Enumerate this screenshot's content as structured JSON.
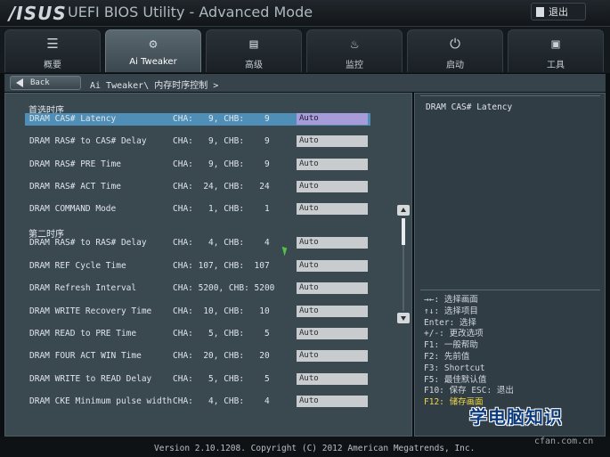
{
  "header": {
    "logo": "/ISUS",
    "title": "UEFI BIOS Utility - Advanced Mode",
    "exit_label": "退出"
  },
  "tabs": [
    {
      "label": "概要",
      "icon": "list-icon",
      "active": false
    },
    {
      "label": "Ai Tweaker",
      "icon": "ai-tweaker-icon",
      "active": true
    },
    {
      "label": "高级",
      "icon": "advanced-icon",
      "active": false
    },
    {
      "label": "监控",
      "icon": "monitor-icon",
      "active": false
    },
    {
      "label": "启动",
      "icon": "power-icon",
      "active": false
    },
    {
      "label": "工具",
      "icon": "toolbox-icon",
      "active": false
    }
  ],
  "nav": {
    "back_label": "Back",
    "breadcrumb": "Ai Tweaker\\  内存时序控制 >"
  },
  "sections": {
    "primary": "首选时序",
    "secondary": "第二时序"
  },
  "rows": [
    {
      "name": "DRAM CAS# Latency",
      "cha": "CHA:   9, CHB:    9",
      "value": "Auto",
      "selected": true
    },
    {
      "name": "DRAM RAS# to CAS# Delay",
      "cha": "CHA:   9, CHB:    9",
      "value": "Auto"
    },
    {
      "name": "DRAM RAS# PRE Time",
      "cha": "CHA:   9, CHB:    9",
      "value": "Auto"
    },
    {
      "name": "DRAM RAS# ACT Time",
      "cha": "CHA:  24, CHB:   24",
      "value": "Auto"
    },
    {
      "name": "DRAM COMMAND Mode",
      "cha": "CHA:   1, CHB:    1",
      "value": "Auto"
    },
    {
      "name": "DRAM RAS# to RAS# Delay",
      "cha": "CHA:   4, CHB:    4",
      "value": "Auto"
    },
    {
      "name": "DRAM REF Cycle Time",
      "cha": "CHA: 107, CHB:  107",
      "value": "Auto"
    },
    {
      "name": "DRAM Refresh Interval",
      "cha": "CHA: 5200, CHB: 5200",
      "value": "Auto"
    },
    {
      "name": "DRAM WRITE Recovery Time",
      "cha": "CHA:  10, CHB:   10",
      "value": "Auto"
    },
    {
      "name": "DRAM READ to PRE Time",
      "cha": "CHA:   5, CHB:    5",
      "value": "Auto"
    },
    {
      "name": "DRAM FOUR ACT WIN Time",
      "cha": "CHA:  20, CHB:   20",
      "value": "Auto"
    },
    {
      "name": "DRAM WRITE to READ Delay",
      "cha": "CHA:   5, CHB:    5",
      "value": "Auto"
    },
    {
      "name": "DRAM CKE Minimum pulse width",
      "cha": "CHA:   4, CHB:    4",
      "value": "Auto"
    }
  ],
  "help": {
    "title": "DRAM CAS# Latency",
    "keys": [
      "→←: 选择画面",
      "↑↓: 选择项目",
      "Enter: 选择",
      "+/-: 更改选项",
      "F1: 一般帮助",
      "F2: 先前值",
      "F3: Shortcut",
      "F5: 最佳默认值",
      "F10: 保存  ESC: 退出",
      "F12: 储存画面"
    ]
  },
  "footer": {
    "version": "Version 2.10.1208. Copyright (C) 2012 American Megatrends, Inc."
  },
  "watermark": {
    "text": "学电脑知识",
    "sub": "cfan.com.cn"
  },
  "colors": {
    "selected_row": "#4f8fb7",
    "selected_value": "#a89bd9",
    "highlight_key": "#f0d84a"
  }
}
